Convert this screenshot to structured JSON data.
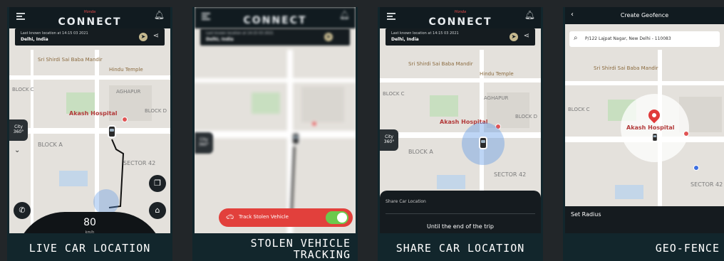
{
  "panels": [
    {
      "caption": "LIVE CAR LOCATION",
      "brand_small": "Honda",
      "brand_big": "CONNECT",
      "info_line1": "Last known location at 14:15 03 2021",
      "info_line2": "Delhi, India",
      "map_labels": {
        "shirdi": "Sri Shirdi Sai Baba Mandir",
        "hindu_temple": "Hindu Temple",
        "block_c": "BLOCK C",
        "aghapur": "AGHAPUR",
        "block_d": "BLOCK D",
        "hospital": "Akash Hospital",
        "block_a": "BLOCK A",
        "sector": "SECTOR 42"
      },
      "side_chip": "City 360°",
      "speed": "80",
      "speed_unit": "km/h"
    },
    {
      "caption": "STOLEN VEHICLE TRACKING",
      "brand_big": "CONNECT",
      "info_line1": "Last known location at 14:15 03 2021",
      "info_line2": "Delhi, India",
      "track_label": "Track Stolen Vehicle",
      "side_chip": "City 360°",
      "toggle_on": true
    },
    {
      "caption": "SHARE CAR LOCATION",
      "brand_small": "Honda",
      "brand_big": "CONNECT",
      "info_line1": "Last known location at 14:15 03 2021",
      "info_line2": "Delhi, India",
      "side_chip": "City 360°",
      "sheet_title": "Share Car Location",
      "sheet_option": "Until the end of the trip"
    },
    {
      "caption": "GEO-FENCE",
      "title": "Create Geofence",
      "search_text": "P/122 Lajpat Nagar, New Delhi - 110083",
      "set_radius": "Set Radius"
    }
  ],
  "colors": {
    "panel_bg": "#12262c",
    "page_bg": "#222629",
    "accent_red": "#e2403c",
    "toggle_green": "#6cc94d"
  }
}
